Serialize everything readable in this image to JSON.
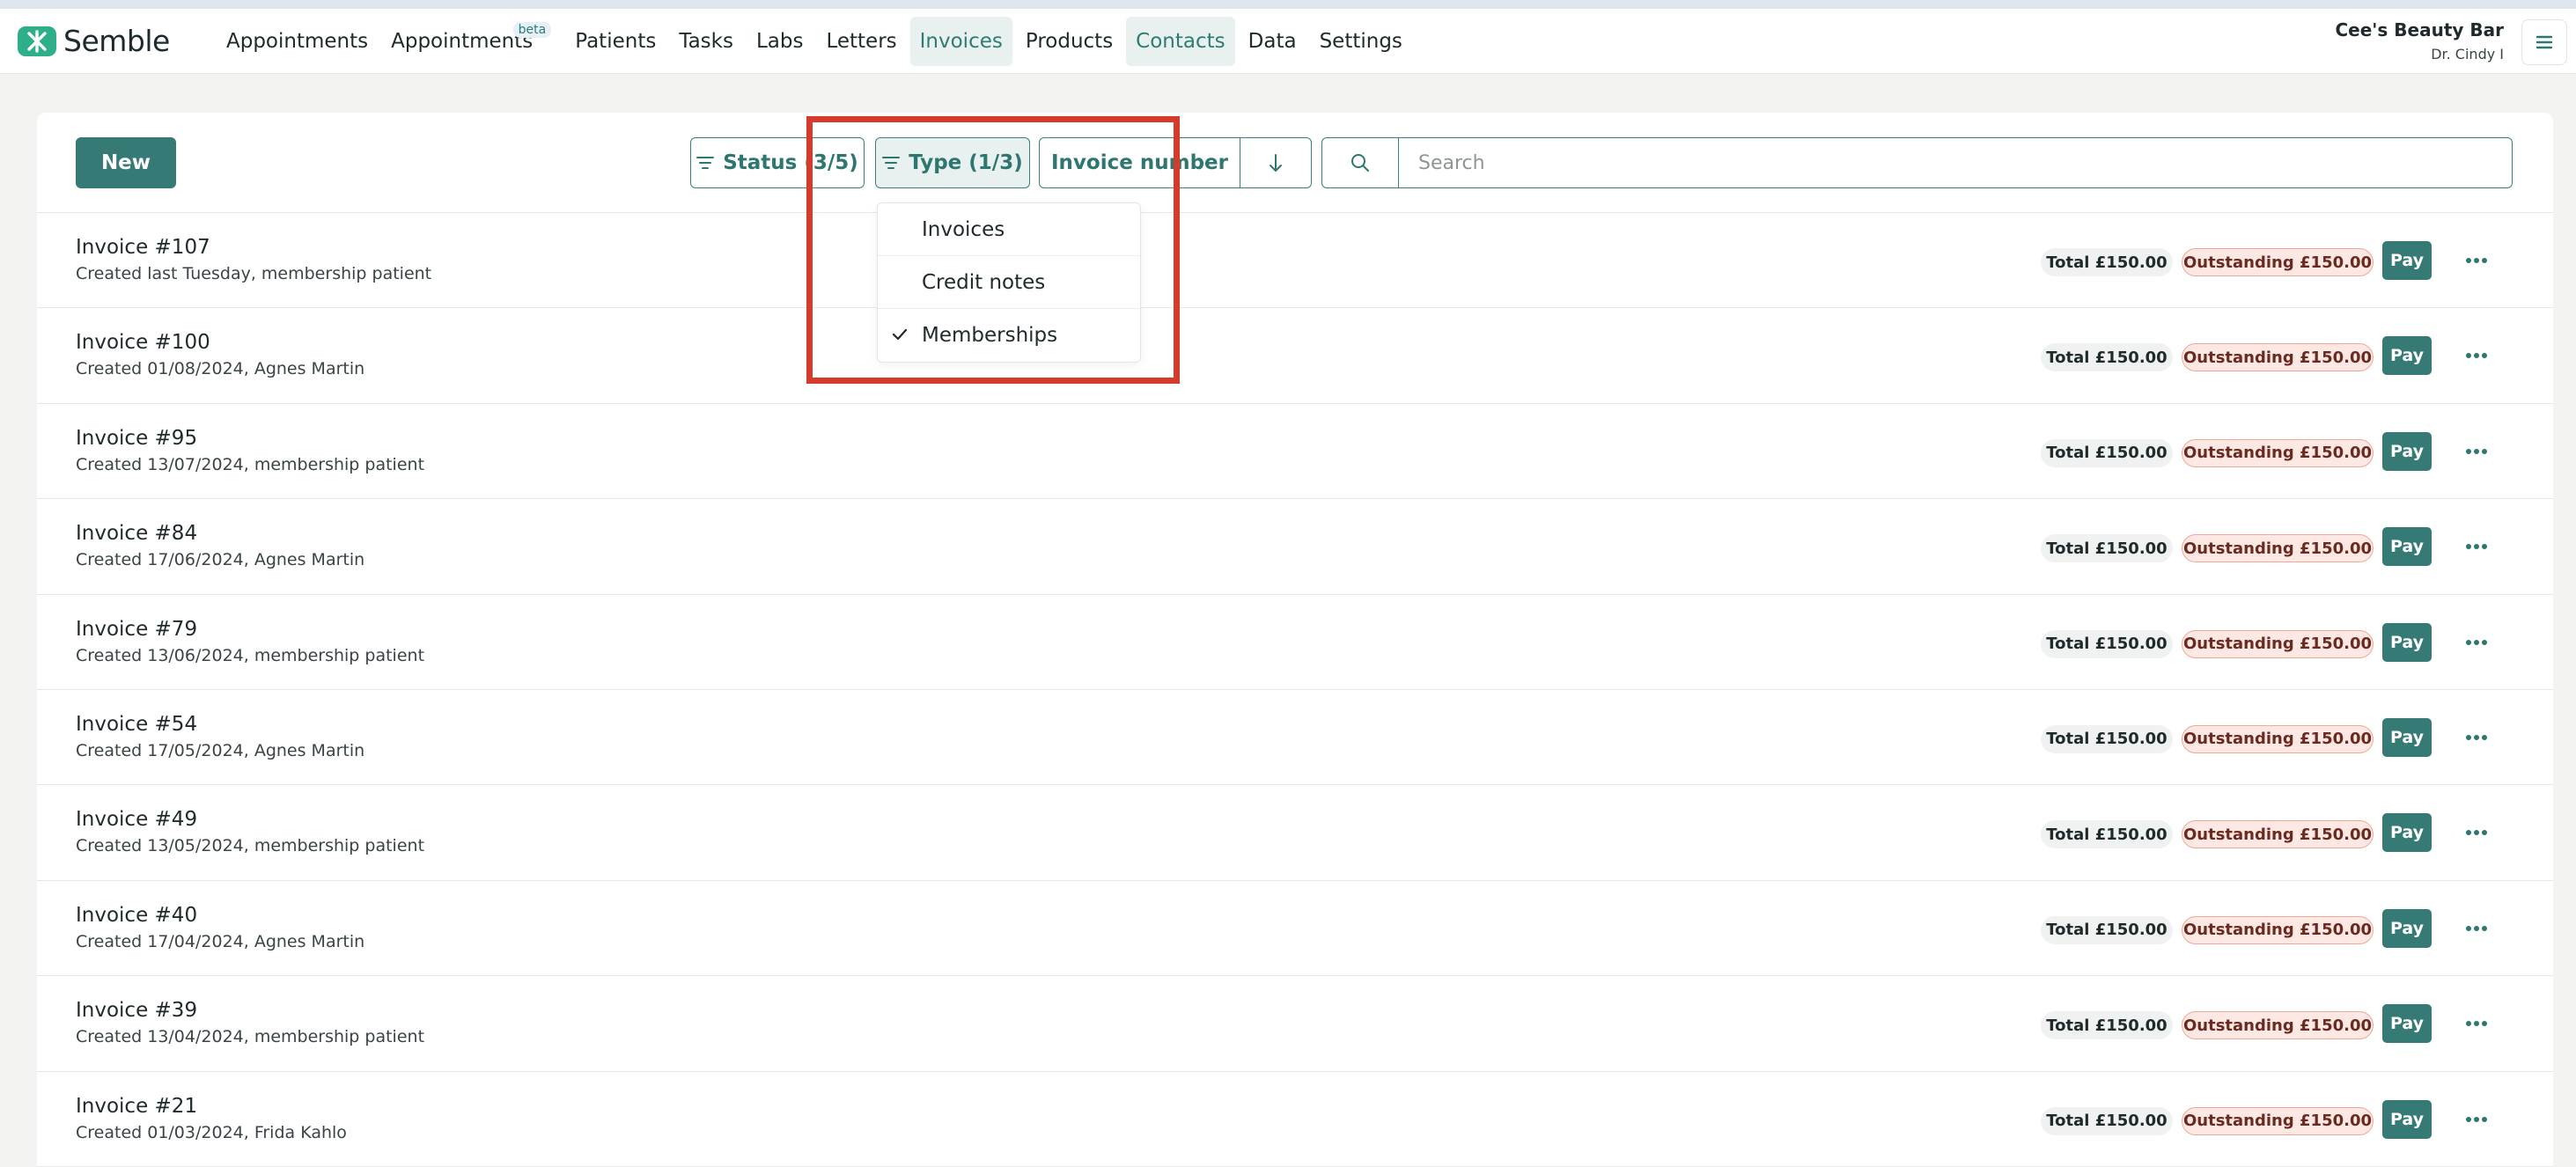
{
  "app": {
    "name": "Semble"
  },
  "nav": {
    "items": [
      {
        "label": "Appointments",
        "badge": null,
        "state": "normal"
      },
      {
        "label": "Appointments",
        "badge": "beta",
        "state": "normal"
      },
      {
        "label": "Patients",
        "badge": null,
        "state": "normal"
      },
      {
        "label": "Tasks",
        "badge": null,
        "state": "normal"
      },
      {
        "label": "Labs",
        "badge": null,
        "state": "normal"
      },
      {
        "label": "Letters",
        "badge": null,
        "state": "normal"
      },
      {
        "label": "Invoices",
        "badge": null,
        "state": "active"
      },
      {
        "label": "Products",
        "badge": null,
        "state": "normal"
      },
      {
        "label": "Contacts",
        "badge": null,
        "state": "tinted"
      },
      {
        "label": "Data",
        "badge": null,
        "state": "normal"
      },
      {
        "label": "Settings",
        "badge": null,
        "state": "normal"
      }
    ]
  },
  "account": {
    "business": "Cee's Beauty Bar",
    "user": "Dr. Cindy I"
  },
  "toolbar": {
    "new_label": "New",
    "status_filter_label": "Status (3/5)",
    "type_filter_label": "Type (1/3)",
    "sort_field_label": "Invoice number",
    "search_placeholder": "Search"
  },
  "type_dropdown": {
    "options": [
      {
        "label": "Invoices",
        "checked": false
      },
      {
        "label": "Credit notes",
        "checked": false
      },
      {
        "label": "Memberships",
        "checked": true
      }
    ]
  },
  "row_labels": {
    "pay": "Pay"
  },
  "invoices": [
    {
      "title": "Invoice #107",
      "subtitle": "Created last Tuesday, membership patient",
      "total": "Total £150.00",
      "outstanding": "Outstanding £150.00"
    },
    {
      "title": "Invoice #100",
      "subtitle": "Created 01/08/2024, Agnes Martin",
      "total": "Total £150.00",
      "outstanding": "Outstanding £150.00"
    },
    {
      "title": "Invoice #95",
      "subtitle": "Created 13/07/2024, membership patient",
      "total": "Total £150.00",
      "outstanding": "Outstanding £150.00"
    },
    {
      "title": "Invoice #84",
      "subtitle": "Created 17/06/2024, Agnes Martin",
      "total": "Total £150.00",
      "outstanding": "Outstanding £150.00"
    },
    {
      "title": "Invoice #79",
      "subtitle": "Created 13/06/2024, membership patient",
      "total": "Total £150.00",
      "outstanding": "Outstanding £150.00"
    },
    {
      "title": "Invoice #54",
      "subtitle": "Created 17/05/2024, Agnes Martin",
      "total": "Total £150.00",
      "outstanding": "Outstanding £150.00"
    },
    {
      "title": "Invoice #49",
      "subtitle": "Created 13/05/2024, membership patient",
      "total": "Total £150.00",
      "outstanding": "Outstanding £150.00"
    },
    {
      "title": "Invoice #40",
      "subtitle": "Created 17/04/2024, Agnes Martin",
      "total": "Total £150.00",
      "outstanding": "Outstanding £150.00"
    },
    {
      "title": "Invoice #39",
      "subtitle": "Created 13/04/2024, membership patient",
      "total": "Total £150.00",
      "outstanding": "Outstanding £150.00"
    },
    {
      "title": "Invoice #21",
      "subtitle": "Created 01/03/2024, Frida Kahlo",
      "total": "Total £150.00",
      "outstanding": "Outstanding £150.00"
    }
  ],
  "colors": {
    "brand": "#357a75",
    "logo": "#2fae8a",
    "highlight": "#d63a2a",
    "outstanding_bg": "#fde8e3",
    "outstanding_border": "#f0a899"
  },
  "icons": {
    "logo": "semble-logo-icon",
    "menu": "hamburger-menu-icon",
    "filter": "filter-icon",
    "sort": "arrow-down-icon",
    "search": "search-icon",
    "more": "ellipsis-icon",
    "check": "check-icon"
  }
}
